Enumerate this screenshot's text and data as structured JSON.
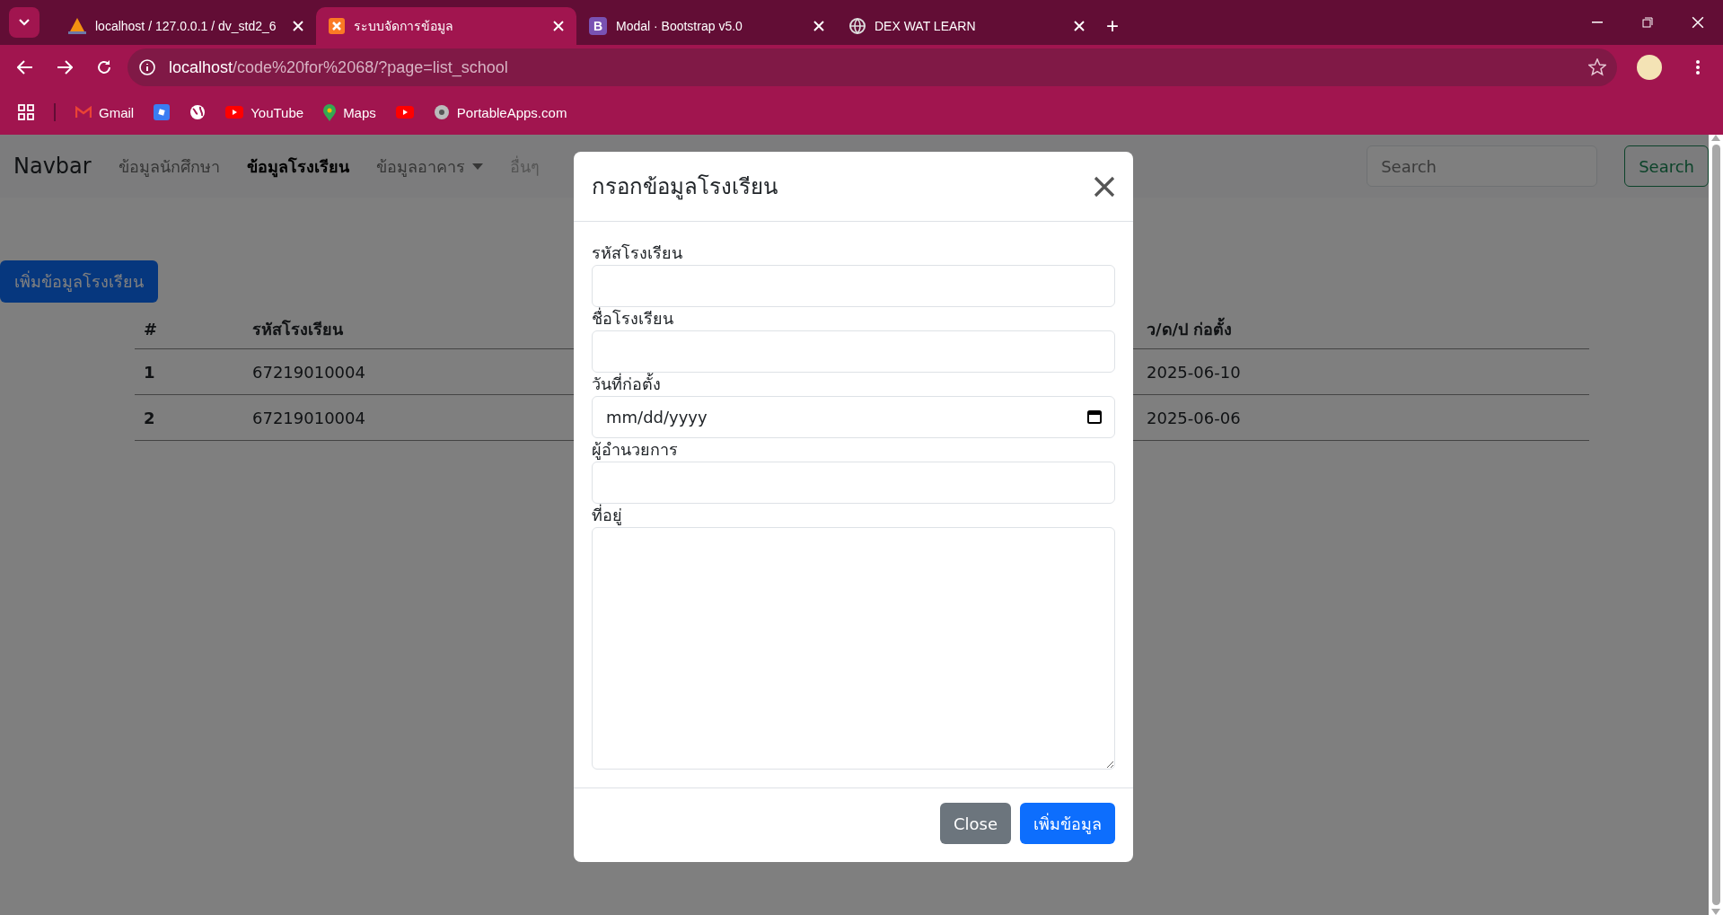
{
  "browser": {
    "tabs": [
      {
        "title": "localhost / 127.0.0.1 / dv_std2_6",
        "selected": false
      },
      {
        "title": "ระบบจัดการข้อมูล",
        "selected": true
      },
      {
        "title": "Modal · Bootstrap v5.0",
        "badge": "B",
        "selected": false
      },
      {
        "title": "DEX WAT LEARN",
        "selected": false
      }
    ],
    "new_tab": "+",
    "address": {
      "host": "localhost",
      "path": "/code%20for%2068/?page=list_school"
    },
    "bookmarks": [
      {
        "kind": "labeled",
        "label": "Gmail"
      },
      {
        "kind": "icon_only"
      },
      {
        "kind": "icon_only"
      },
      {
        "kind": "labeled",
        "label": "YouTube"
      },
      {
        "kind": "labeled",
        "label": "Maps"
      },
      {
        "kind": "icon_only"
      },
      {
        "kind": "labeled",
        "label": "PortableApps.com"
      }
    ]
  },
  "navbar": {
    "brand": "Navbar",
    "links": [
      {
        "label": "ข้อมูลนักศึกษา",
        "kind": "link",
        "active": false,
        "disabled": false
      },
      {
        "label": "ข้อมูลโรงเรียน",
        "kind": "link",
        "active": true,
        "disabled": false
      },
      {
        "label": "ข้อมูลอาคาร",
        "kind": "dropdown",
        "active": false,
        "disabled": false
      },
      {
        "label": "อื่นๆ",
        "kind": "link",
        "active": false,
        "disabled": true
      }
    ],
    "search": {
      "placeholder": "Search",
      "button": "Search"
    }
  },
  "add_button": "เพิ่มข้อมูลโรงเรียน",
  "table": {
    "columns": [
      "#",
      "รหัสโรงเรียน",
      "ว/ด/ป ก่อตั้ง"
    ],
    "rows": [
      [
        "1",
        "67219010004",
        "2025-06-10"
      ],
      [
        "2",
        "67219010004",
        "2025-06-06"
      ]
    ]
  },
  "modal": {
    "title": "กรอกข้อมูลโรงเรียน",
    "fields": [
      {
        "label": "รหัสโรงเรียน",
        "kind": "text"
      },
      {
        "label": "ชื่อโรงเรียน",
        "kind": "text"
      },
      {
        "label": "วันที่ก่อตั้ง",
        "kind": "date",
        "placeholder": "mm/dd/yyyy"
      },
      {
        "label": "ผู้อำนวยการ",
        "kind": "text"
      },
      {
        "label": "ที่อยู่",
        "kind": "textarea"
      }
    ],
    "buttons": [
      {
        "label": "Close",
        "kind": "secondary"
      },
      {
        "label": "เพิ่มข้อมูล",
        "kind": "primary"
      }
    ]
  }
}
